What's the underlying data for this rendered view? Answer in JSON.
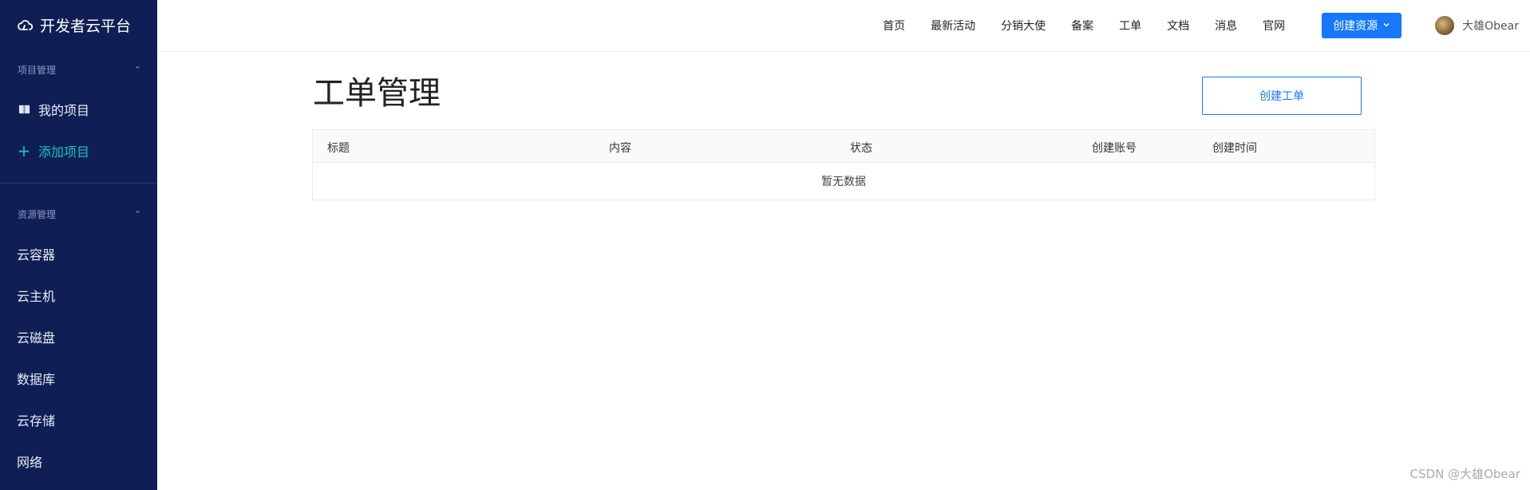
{
  "brand": {
    "title": "开发者云平台"
  },
  "sidebar": {
    "project_section": "项目管理",
    "project_items": [
      {
        "label": "我的项目"
      },
      {
        "label": "添加项目"
      }
    ],
    "resource_section": "资源管理",
    "resource_items": [
      {
        "label": "云容器"
      },
      {
        "label": "云主机"
      },
      {
        "label": "云磁盘"
      },
      {
        "label": "数据库"
      },
      {
        "label": "云存储"
      },
      {
        "label": "网络"
      }
    ]
  },
  "topnav": {
    "links": [
      "首页",
      "最新活动",
      "分销大使",
      "备案",
      "工单",
      "文档",
      "消息",
      "官网"
    ],
    "create_button": "创建资源",
    "user_name": "大雄Obear"
  },
  "main": {
    "title": "工单管理",
    "create_ticket_button": "创建工单",
    "table": {
      "columns": [
        "标题",
        "内容",
        "状态",
        "创建账号",
        "创建时间"
      ],
      "empty_text": "暂无数据"
    }
  },
  "watermark": "CSDN @大雄Obear",
  "colors": {
    "sidebar": "#0f1f55",
    "accent": "#1677ff",
    "add_item": "#19c3c3"
  }
}
